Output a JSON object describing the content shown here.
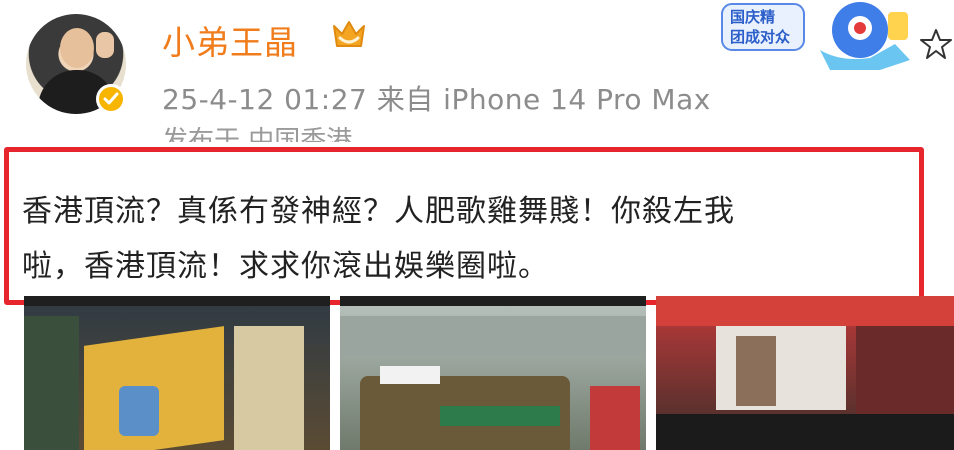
{
  "post": {
    "username": "小弟王晶",
    "meta_line": "25-4-12 01:27  来自 iPhone 14 Pro Max",
    "location": "发布于 中国香港",
    "content_line1": "香港頂流？真係冇發神經？人肥歌雞舞賤！你殺左我",
    "content_line2": "啦，香港頂流！求求你滾出娛樂圈啦。"
  },
  "badge": {
    "line1": "国庆精",
    "line2": "团成对众"
  },
  "colors": {
    "username": "#f07c1b",
    "highlight_border": "#e6262c",
    "meta_text": "#8c8c8c",
    "verified_badge": "#f7b500"
  },
  "icons": {
    "verified": "check-icon",
    "crown": "crown-icon",
    "star": "star-icon"
  }
}
